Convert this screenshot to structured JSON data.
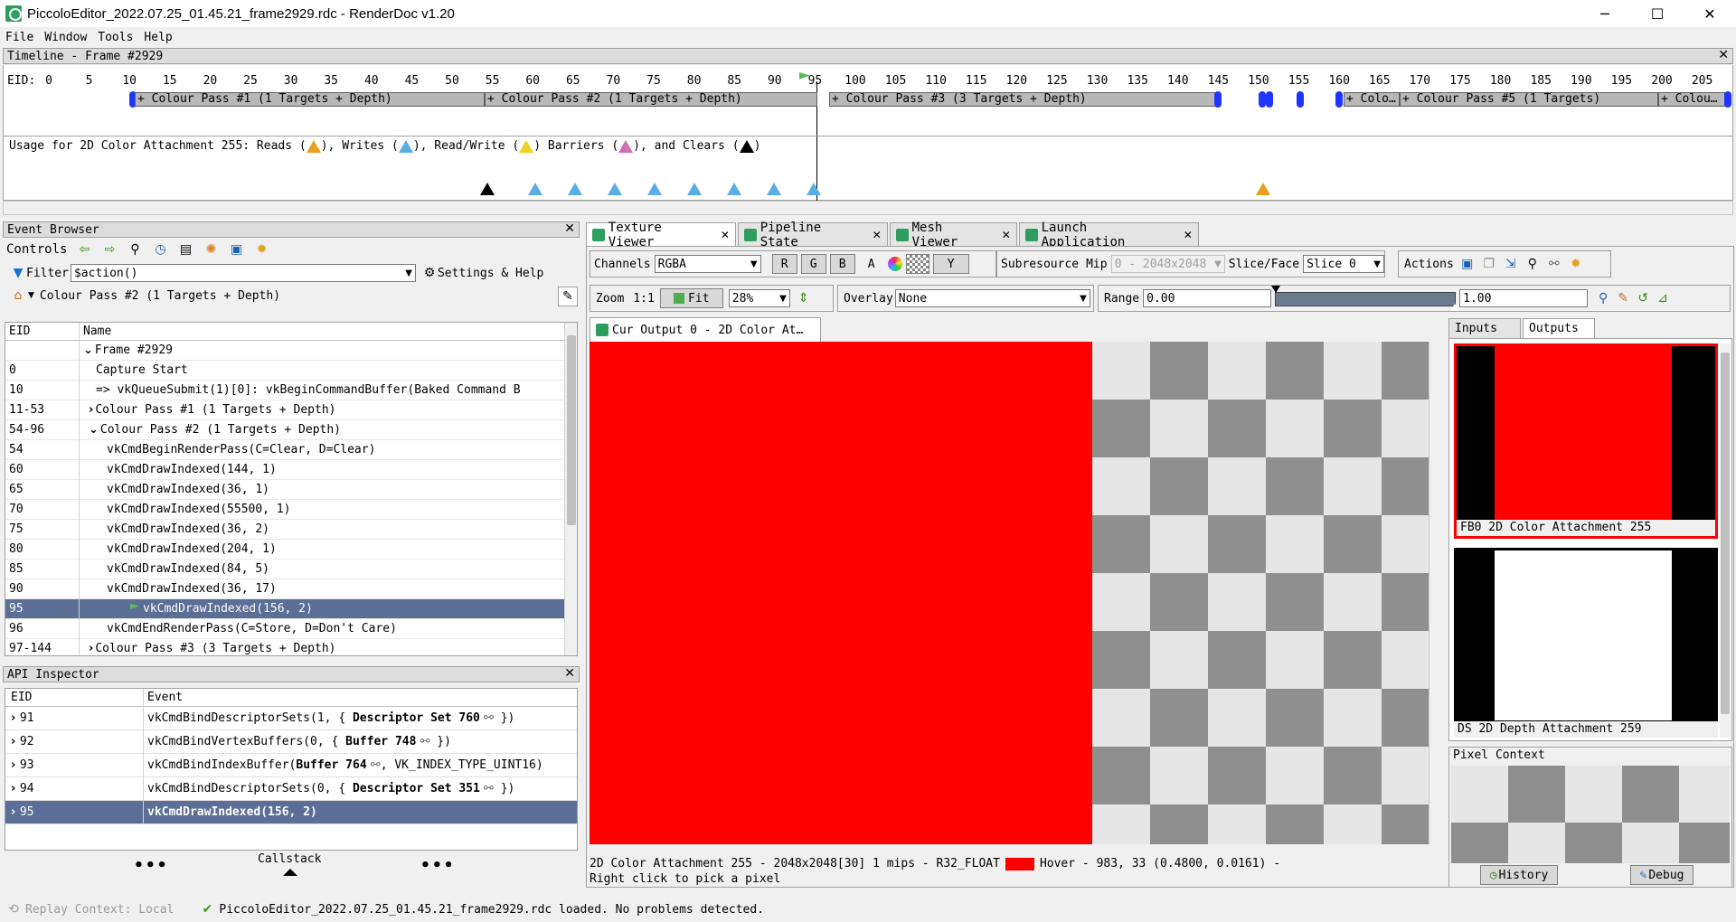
{
  "window": {
    "title": "PiccoloEditor_2022.07.25_01.45.21_frame2929.rdc - RenderDoc v1.20",
    "controls": [
      "─",
      "☐",
      "✕"
    ]
  },
  "menu": [
    "File",
    "Window",
    "Tools",
    "Help"
  ],
  "timeline": {
    "title": "Timeline - Frame #2929",
    "eid_label": "EID:",
    "ticks": [
      "0",
      "5",
      "10",
      "15",
      "20",
      "25",
      "30",
      "35",
      "40",
      "45",
      "50",
      "55",
      "60",
      "65",
      "70",
      "75",
      "80",
      "85",
      "90",
      "95",
      "100",
      "105",
      "110",
      "115",
      "120",
      "125",
      "130",
      "135",
      "140",
      "145",
      "150",
      "155",
      "160",
      "165",
      "170",
      "175",
      "180",
      "185",
      "190",
      "195",
      "200",
      "205"
    ],
    "passes": [
      "+ Colour Pass #1 (1 Targets + Depth)",
      "+ Colour Pass #2 (1 Targets + Depth)",
      "+ Colour Pass #3 (3 Targets + Depth)",
      "+ Colo…",
      "+ Colour Pass #5 (1 Targets)",
      "+ Colou…"
    ],
    "usage_prefix": "Usage for 2D Color Attachment 255: Reads (",
    "usage_writes": "), Writes (",
    "usage_rw": "), Read/Write (",
    "usage_barriers": ") Barriers (",
    "usage_clears": "), and Clears (",
    "usage_end": ")"
  },
  "event_browser": {
    "title": "Event Browser",
    "controls_label": "Controls",
    "filter_label": "Filter",
    "filter_value": "$action()",
    "settings_label": "Settings & Help",
    "breadcrumb": "Colour Pass #2 (1 Targets + Depth)",
    "col_eid": "EID",
    "col_name": "Name",
    "rows": [
      {
        "eid": "",
        "name": "Frame #2929"
      },
      {
        "eid": "0",
        "name": "Capture Start"
      },
      {
        "eid": "10",
        "name": "=>  vkQueueSubmit(1)[0]:  vkBeginCommandBuffer(Baked Command B"
      },
      {
        "eid": "11-53",
        "name": "Colour Pass #1 (1 Targets + Depth)"
      },
      {
        "eid": "54-96",
        "name": "Colour Pass #2 (1 Targets + Depth)"
      },
      {
        "eid": "54",
        "name": "vkCmdBeginRenderPass(C=Clear, D=Clear)"
      },
      {
        "eid": "60",
        "name": "vkCmdDrawIndexed(144, 1)"
      },
      {
        "eid": "65",
        "name": "vkCmdDrawIndexed(36, 1)"
      },
      {
        "eid": "70",
        "name": "vkCmdDrawIndexed(55500, 1)"
      },
      {
        "eid": "75",
        "name": "vkCmdDrawIndexed(36, 2)"
      },
      {
        "eid": "80",
        "name": "vkCmdDrawIndexed(204, 1)"
      },
      {
        "eid": "85",
        "name": "vkCmdDrawIndexed(84, 5)"
      },
      {
        "eid": "90",
        "name": "vkCmdDrawIndexed(36, 17)"
      },
      {
        "eid": "95",
        "name": "vkCmdDrawIndexed(156, 2)"
      },
      {
        "eid": "96",
        "name": "vkCmdEndRenderPass(C=Store, D=Don't Care)"
      },
      {
        "eid": "97-144",
        "name": "Colour Pass #3 (3 Targets + Depth)"
      }
    ]
  },
  "api_inspector": {
    "title": "API Inspector",
    "col_eid": "EID",
    "col_event": "Event",
    "rows": [
      {
        "eid": "91",
        "pre": "vkCmdBindDescriptorSets(1,  {  ",
        "bold": "Descriptor Set 760",
        "post": "  })"
      },
      {
        "eid": "92",
        "pre": "vkCmdBindVertexBuffers(0,  {  ",
        "bold": "Buffer 748",
        "post": "  })"
      },
      {
        "eid": "93",
        "pre": "vkCmdBindIndexBuffer(",
        "bold": "Buffer 764",
        "post": ",  VK_INDEX_TYPE_UINT16)"
      },
      {
        "eid": "94",
        "pre": "vkCmdBindDescriptorSets(0,  {  ",
        "bold": "Descriptor Set 351",
        "post": "  })"
      },
      {
        "eid": "95",
        "pre": "",
        "bold": "vkCmdDrawIndexed(156,  2)",
        "post": ""
      }
    ],
    "callstack_label": "Callstack"
  },
  "tabs": [
    "Texture Viewer",
    "Pipeline State",
    "Mesh Viewer",
    "Launch Application"
  ],
  "texture_viewer": {
    "channels_label": "Channels",
    "channels_value": "RGBA",
    "channel_buttons": [
      "R",
      "G",
      "B",
      "A"
    ],
    "y_button": "Y",
    "subresource_label": "Subresource",
    "mip_label": "Mip",
    "mip_value": "0 - 2048x2048",
    "slice_label": "Slice/Face",
    "slice_value": "Slice 0",
    "actions_label": "Actions",
    "zoom_label": "Zoom",
    "zoom_1to1": "1:1",
    "fit_label": "Fit",
    "zoom_value": "28%",
    "overlay_label": "Overlay",
    "overlay_value": "None",
    "range_label": "Range",
    "range_min": "0.00",
    "range_max": "1.00",
    "output_tab": "Cur Output 0 - 2D Color At…",
    "status_line1_a": "2D Color Attachment 255 - 2048x2048[30] 1 mips - R32_FLOAT",
    "status_line1_b": "Hover -    983,    33 (0.4800, 0.0161)  -",
    "status_line2": "Right click to pick a pixel",
    "red_color": "#ff0000"
  },
  "thumbnails": {
    "tab_inputs": "Inputs",
    "tab_outputs": "Outputs",
    "items": [
      {
        "label": "FB0     2D Color Attachment 255"
      },
      {
        "label": "DS      2D Depth Attachment 259"
      }
    ]
  },
  "pixel_context": {
    "title": "Pixel Context",
    "history_label": "History",
    "debug_label": "Debug"
  },
  "statusbar": {
    "replay": "Replay Context: Local",
    "message": "PiccoloEditor_2022.07.25_01.45.21_frame2929.rdc loaded.  No problems detected."
  }
}
